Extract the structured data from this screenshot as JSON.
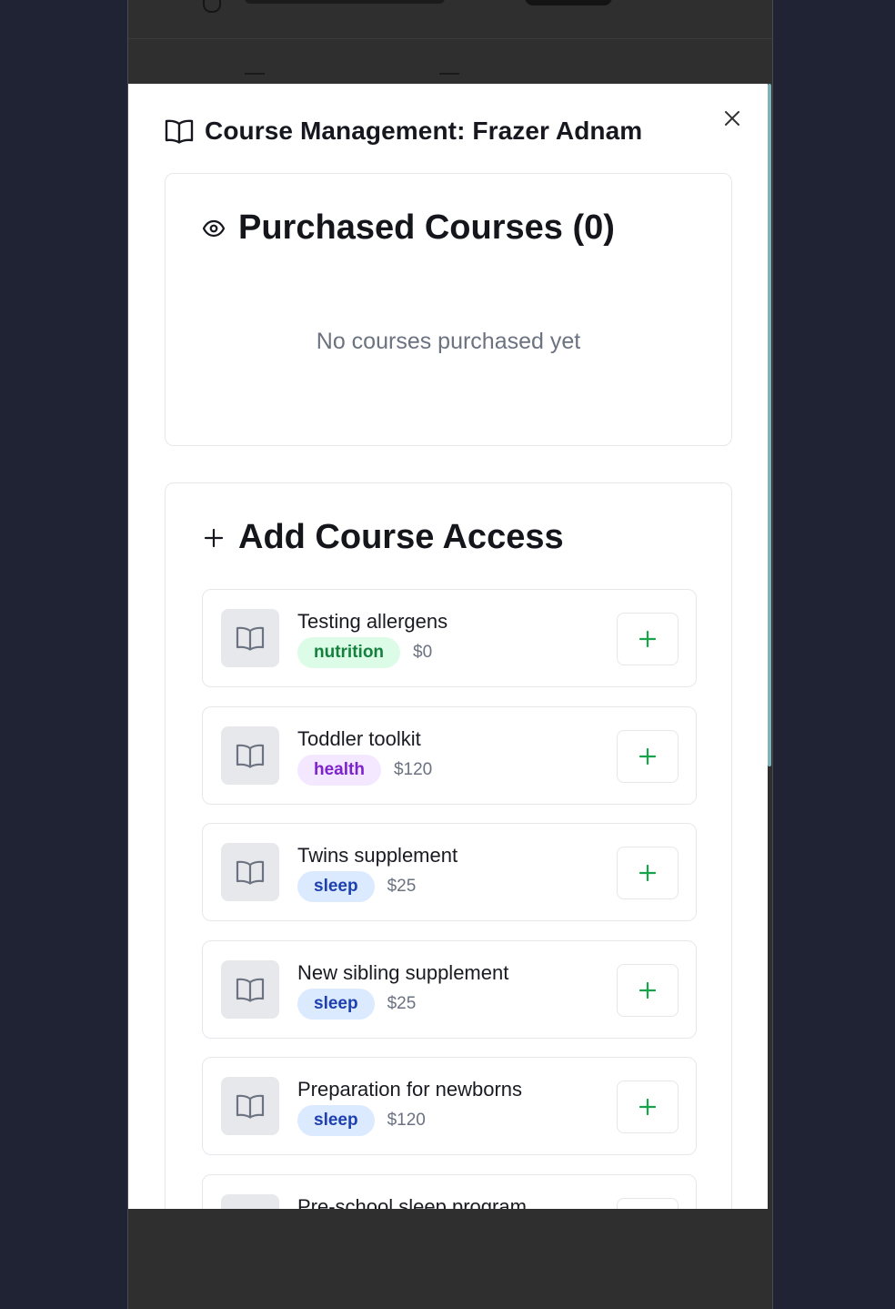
{
  "modal": {
    "title": "Course Management: Frazer Adnam",
    "purchased": {
      "heading": "Purchased Courses (0)",
      "empty_text": "No courses purchased yet"
    },
    "add_access": {
      "heading": "Add Course Access",
      "courses": [
        {
          "name": "Testing allergens",
          "category": "nutrition",
          "price": "$0"
        },
        {
          "name": "Toddler toolkit",
          "category": "health",
          "price": "$120"
        },
        {
          "name": "Twins supplement",
          "category": "sleep",
          "price": "$25"
        },
        {
          "name": "New sibling supplement",
          "category": "sleep",
          "price": "$25"
        },
        {
          "name": "Preparation for newborns",
          "category": "sleep",
          "price": "$120"
        },
        {
          "name": "Pre-school sleep program",
          "category": "",
          "price": ""
        }
      ]
    }
  },
  "colors": {
    "overlay": "#2f2f2f",
    "page_bg": "#1f2333",
    "add_icon": "#16a34a",
    "nutrition_badge": "#dcfce7",
    "health_badge": "#f3e8ff",
    "sleep_badge": "#dbeafe"
  },
  "icons": {
    "title": "book-open-icon",
    "purchased": "eye-icon",
    "add_access": "plus-icon",
    "course_thumb": "book-open-icon",
    "course_action": "plus-icon",
    "close": "close-icon"
  }
}
